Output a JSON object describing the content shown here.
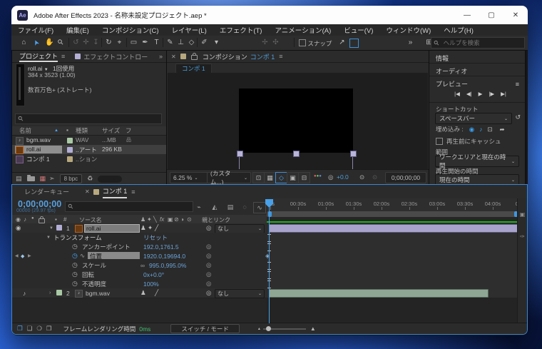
{
  "titlebar": {
    "app_icon": "Ae",
    "title": "Adobe After Effects 2023 - 名称未設定プロジェクト.aep *",
    "min": "—",
    "max": "▢",
    "close": "✕"
  },
  "menubar": {
    "items": [
      "ファイル(F)",
      "編集(E)",
      "コンポジション(C)",
      "レイヤー(L)",
      "エフェクト(T)",
      "アニメーション(A)",
      "ビュー(V)",
      "ウィンドウ(W)",
      "ヘルプ(H)"
    ]
  },
  "toolbar": {
    "tools": [
      "⌂",
      "➤",
      "✋",
      "⚲",
      "↺",
      "✛",
      "↧",
      "↻",
      "⌖",
      "▭",
      "✒",
      "T",
      "✎",
      "⊥",
      "◇",
      "✐",
      "▾",
      "✢",
      "✣"
    ],
    "snap_label": "スナップ",
    "camera_arrow": "↗",
    "more": "»",
    "workspace_glyph": "⊞",
    "search_placeholder": "ヘルプを検索"
  },
  "project": {
    "tab_project": "プロジェクト",
    "tab_menu": "≡",
    "tab_effects": "エフェクトコントロール roll.ai",
    "overflow": "»",
    "selected_name": "roll.ai",
    "usage": "1回使用",
    "dimensions": "384 x 3523 (1.00)",
    "color_depth": "数百万色+ (ストレート)",
    "sort_arrow": "▲",
    "columns": {
      "name": "名前",
      "tag": "▪",
      "type": "種類",
      "size": "サイズ",
      "path": "フ"
    },
    "rows": [
      {
        "name": "bgm.wav",
        "type": "WAV",
        "size": "...MB"
      },
      {
        "name": "roll.ai",
        "type": "..アート",
        "size": "296 KB"
      },
      {
        "name": "コンポ 1",
        "type": "..ション",
        "size": ""
      }
    ],
    "bpc": "8 bpc"
  },
  "viewer": {
    "close": "✕",
    "tab_label": "コンポジション",
    "comp_name": "コンポ 1",
    "menu": "≡",
    "breadcrumb": "コンポ 1",
    "zoom": "6.25 %",
    "resolution": "(カスタム...)",
    "icons": [
      "⊡",
      "▦",
      "◇",
      "▣",
      "⊟"
    ],
    "dot": "●",
    "exposure_icon": "◎",
    "exposure": "+0.0",
    "camera_icon": "⊙",
    "timecode": "0;00;00;00",
    "chevron": "⌄"
  },
  "rightpanel": {
    "info": "情報",
    "audio": "オーディオ",
    "preview": "プレビュー",
    "menu": "≡",
    "transport": [
      "|◀",
      "◀|",
      "▶",
      "|▶",
      "▶|"
    ],
    "shortcut_label": "ショートカット",
    "shortcut_value": "スペースバー",
    "reset_glyph": "↺",
    "include_label": "埋め込み :",
    "eye": "◉",
    "speaker": "♪",
    "frame_icon": "⊡",
    "share_icon": "➦",
    "cache_label": "再生前にキャッシュ",
    "range_label": "範囲",
    "range_value": "ワークエリアと現在の時間",
    "start_label": "再生開始の時間",
    "start_value": "現在の時間",
    "chevron": "⌄"
  },
  "timeline": {
    "tab_rq": "レンダーキュー",
    "close": "✕",
    "tab_comp": "コンポ 1",
    "menu": "≡",
    "timecode": "0;00;00;00",
    "frames": "00000 (29.97 fps)",
    "panel_icons": [
      "⌁",
      "◭",
      "▤",
      "◌",
      "∿"
    ],
    "col_source": "ソース名",
    "col_parent": "親とリンク",
    "eye": "◉",
    "speaker": "♪",
    "solo": "●",
    "switch_icons": [
      "♟",
      "✦",
      "╲",
      "fx",
      "▣",
      "⊘",
      "◑",
      "⊙"
    ],
    "slash": "╱",
    "pickwhip": "◎",
    "chev_open": "⌄",
    "chev_closed": "›",
    "ruler": [
      "00s",
      "00:30s",
      "01:00s",
      "01:30s",
      "02:00s",
      "02:30s",
      "03:00s",
      "03:30s",
      "04:00s",
      "04:3"
    ],
    "layers": [
      {
        "num": "1",
        "name": "roll.ai",
        "parent_value": "なし"
      },
      {
        "num": "2",
        "name": "bgm.wav",
        "parent_value": "なし"
      }
    ],
    "group_label": "トランスフォーム",
    "reset_label": "リセット",
    "stopwatch": "◷",
    "graph_icon": "∿",
    "scale_link": "∞",
    "keyframe": "◆",
    "nav_prev": "◀",
    "nav_next": "▶",
    "props": [
      {
        "label": "アンカーポイント",
        "value": "192.0,1761.5"
      },
      {
        "label": "位置",
        "value": "1920.0,19694.0"
      },
      {
        "label": "スケール",
        "value": "995.0,995.0%"
      },
      {
        "label": "回転",
        "value": "0x+0.0°"
      },
      {
        "label": "不透明度",
        "value": "100%"
      }
    ],
    "render_label": "フレームレンダリング時間",
    "render_value": "0ms",
    "switches_label": "スイッチ / モード",
    "zoom_small": "▴",
    "zoom_big": "▲"
  }
}
